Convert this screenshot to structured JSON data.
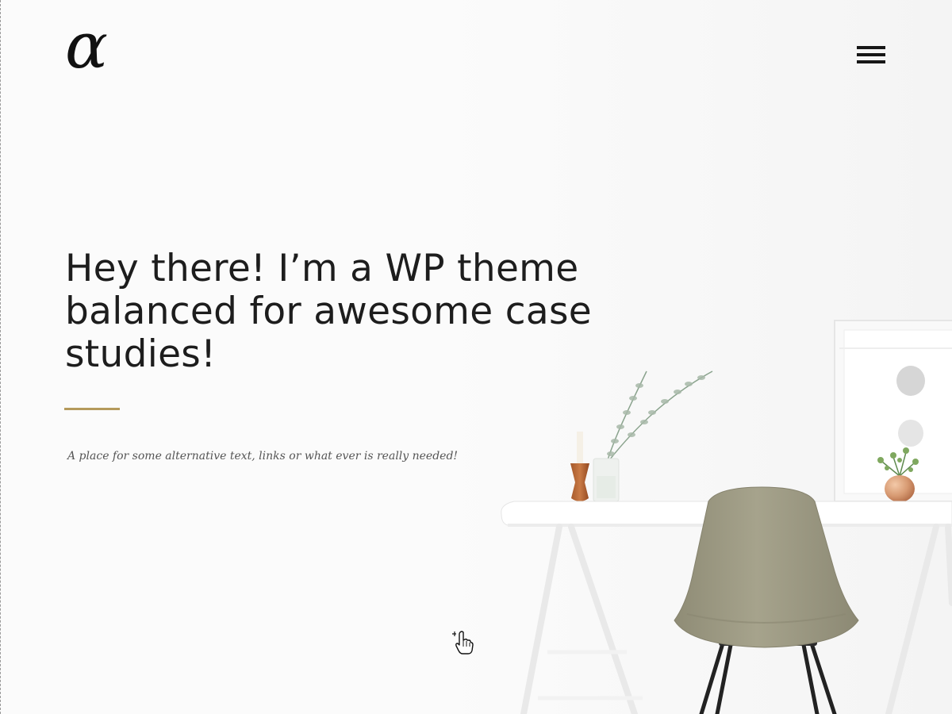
{
  "header": {
    "logo_glyph": "α",
    "menu_icon": "hamburger-menu-icon"
  },
  "hero": {
    "title": "Hey there! I’m a WP theme balanced for awesome case studies!",
    "subtitle": "A place for some alternative text, links or what ever is really needed!",
    "accent_color": "#b59a5b"
  },
  "colors": {
    "background": "#fbfbfb",
    "text": "#1d1d1d",
    "subtitle": "#555555",
    "chair": "#9d9a83"
  }
}
